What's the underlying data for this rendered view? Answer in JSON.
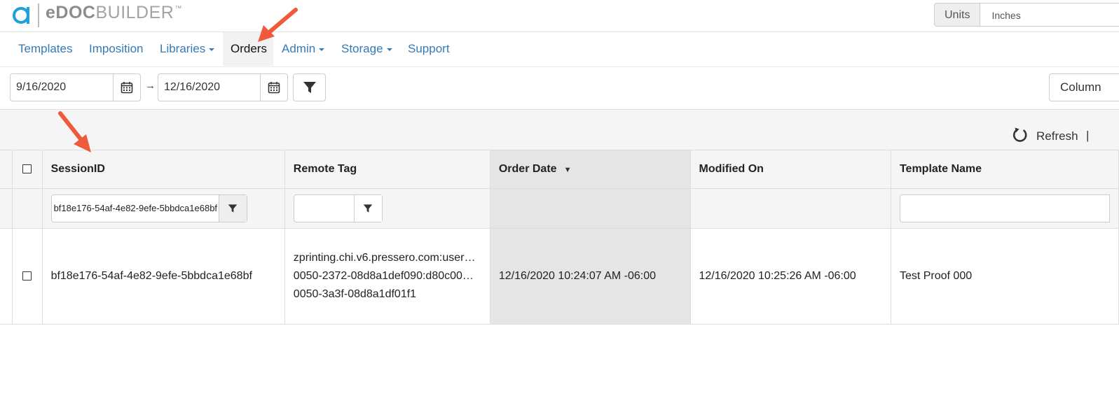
{
  "header": {
    "logo_bold": "eDOC",
    "logo_light": "BUILDER",
    "logo_tm": "™",
    "units_label": "Units",
    "units_value": "Inches"
  },
  "nav": {
    "items": [
      {
        "label": "Templates"
      },
      {
        "label": "Imposition"
      },
      {
        "label": "Libraries"
      },
      {
        "label": "Orders"
      },
      {
        "label": "Admin"
      },
      {
        "label": "Storage"
      },
      {
        "label": "Support"
      }
    ],
    "active": "Orders"
  },
  "filters": {
    "start_date": "9/16/2020",
    "end_date": "12/16/2020",
    "range_separator": "→",
    "columns_label": "Column"
  },
  "toolbar": {
    "refresh_label": "Refresh",
    "divider": "|"
  },
  "grid": {
    "columns": [
      "SessionID",
      "Remote Tag",
      "Order Date",
      "Modified On",
      "Template Name"
    ],
    "sort_column": "Order Date",
    "sort_direction": "descending",
    "sort_indicator": "▼",
    "filters": {
      "session_id": "bf18e176-54af-4e82-9efe-5bbdca1e68bf"
    },
    "rows": [
      {
        "session_id": "bf18e176-54af-4e82-9efe-5bbdca1e68bf",
        "remote_tag_lines": [
          "zprinting.chi.v6.pressero.com:user…",
          "0050-2372-08d8a1def090:d80c00…",
          "0050-3a3f-08d8a1df01f1"
        ],
        "order_date": "12/16/2020 10:24:07 AM -06:00",
        "modified_on": "12/16/2020 10:25:26 AM -06:00",
        "template_name": "Test Proof 000"
      }
    ]
  },
  "colors": {
    "link": "#337ab7",
    "logo_accent": "#1fa0d8",
    "annotation_arrow": "#ef5a3c"
  }
}
